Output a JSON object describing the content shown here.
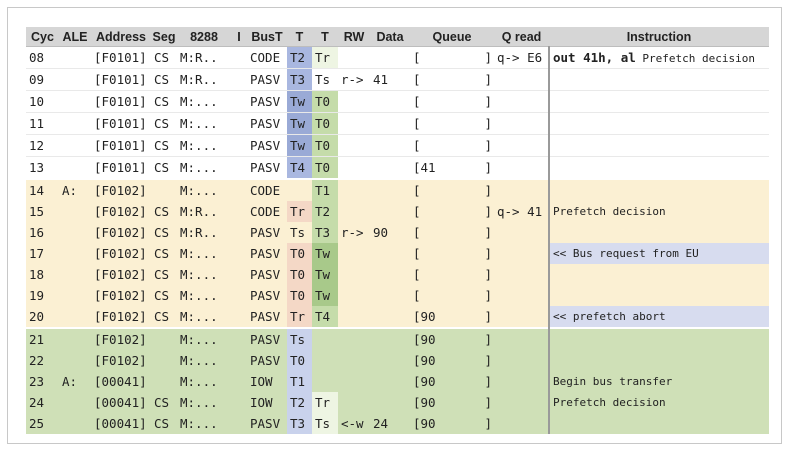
{
  "headers": [
    "Cyc",
    "ALE",
    "Address",
    "Seg",
    "8288",
    "I",
    "BusT",
    "T",
    "T",
    "RW",
    "Data",
    "Queue",
    "Q read",
    "Instruction"
  ],
  "rows": [
    {
      "cyc": "08",
      "ale": "",
      "addr": "[F0101]",
      "seg": "CS",
      "s8288": "M:R..",
      "i": "",
      "bust": "CODE",
      "t1": "T2",
      "t2": "Tr",
      "rw": "",
      "data": "",
      "queue": "[",
      "qend": "]",
      "qread": "q-> E6",
      "instr_bold": "out 41h, al",
      "instr": " Prefetch decision",
      "band": "white",
      "t1c": "code",
      "t2c": "gw",
      "ic": ""
    },
    {
      "cyc": "09",
      "ale": "",
      "addr": "[F0101]",
      "seg": "CS",
      "s8288": "M:R..",
      "i": "",
      "bust": "PASV",
      "t1": "T3",
      "t2": "Ts",
      "rw": "r->",
      "data": "41",
      "queue": "[",
      "qend": "]",
      "qread": "",
      "instr_bold": "",
      "instr": "",
      "band": "white",
      "t1c": "code",
      "t2c": "",
      "ic": ""
    },
    {
      "cyc": "10",
      "ale": "",
      "addr": "[F0101]",
      "seg": "CS",
      "s8288": "M:...",
      "i": "",
      "bust": "PASV",
      "t1": "Tw",
      "t2": "T0",
      "rw": "",
      "data": "",
      "queue": "[",
      "qend": "]",
      "qread": "",
      "instr_bold": "",
      "instr": "",
      "band": "white",
      "t1c": "blue",
      "t2c": "g",
      "ic": ""
    },
    {
      "cyc": "11",
      "ale": "",
      "addr": "[F0101]",
      "seg": "CS",
      "s8288": "M:...",
      "i": "",
      "bust": "PASV",
      "t1": "Tw",
      "t2": "T0",
      "rw": "",
      "data": "",
      "queue": "[",
      "qend": "]",
      "qread": "",
      "instr_bold": "",
      "instr": "",
      "band": "white",
      "t1c": "blue",
      "t2c": "g",
      "ic": ""
    },
    {
      "cyc": "12",
      "ale": "",
      "addr": "[F0101]",
      "seg": "CS",
      "s8288": "M:...",
      "i": "",
      "bust": "PASV",
      "t1": "Tw",
      "t2": "T0",
      "rw": "",
      "data": "",
      "queue": "[",
      "qend": "]",
      "qread": "",
      "instr_bold": "",
      "instr": "",
      "band": "white",
      "t1c": "blue",
      "t2c": "g",
      "ic": ""
    },
    {
      "cyc": "13",
      "ale": "",
      "addr": "[F0101]",
      "seg": "CS",
      "s8288": "M:...",
      "i": "",
      "bust": "PASV",
      "t1": "T4",
      "t2": "T0",
      "rw": "",
      "data": "",
      "queue": "[41",
      "qend": "]",
      "qread": "",
      "instr_bold": "",
      "instr": "",
      "band": "white",
      "t1c": "code",
      "t2c": "g",
      "ic": ""
    },
    {
      "cyc": "14",
      "ale": "A:",
      "addr": "[F0102]",
      "seg": "",
      "s8288": "M:...",
      "i": "",
      "bust": "CODE",
      "t1": "",
      "t2": "T1",
      "rw": "",
      "data": "",
      "queue": "[",
      "qend": "]",
      "qread": "",
      "instr_bold": "",
      "instr": "",
      "band": "tan",
      "t1c": "",
      "t2c": "g",
      "ic": ""
    },
    {
      "cyc": "15",
      "ale": "",
      "addr": "[F0102]",
      "seg": "CS",
      "s8288": "M:R..",
      "i": "",
      "bust": "CODE",
      "t1": "Tr",
      "t2": "T2",
      "rw": "",
      "data": "",
      "queue": "[",
      "qend": "]",
      "qread": "q-> 41",
      "instr_bold": "",
      "instr": "Prefetch decision",
      "band": "tan",
      "t1c": "salmon",
      "t2c": "g",
      "ic": ""
    },
    {
      "cyc": "16",
      "ale": "",
      "addr": "[F0102]",
      "seg": "CS",
      "s8288": "M:R..",
      "i": "",
      "bust": "PASV",
      "t1": "Ts",
      "t2": "T3",
      "rw": "r->",
      "data": "90",
      "queue": "[",
      "qend": "]",
      "qread": "",
      "instr_bold": "",
      "instr": "",
      "band": "tan",
      "t1c": "",
      "t2c": "g",
      "ic": ""
    },
    {
      "cyc": "17",
      "ale": "",
      "addr": "[F0102]",
      "seg": "CS",
      "s8288": "M:...",
      "i": "",
      "bust": "PASV",
      "t1": "T0",
      "t2": "Tw",
      "rw": "",
      "data": "",
      "queue": "[",
      "qend": "]",
      "qread": "",
      "instr_bold": "",
      "instr": "<< Bus request from EU",
      "band": "tan",
      "t1c": "salmon",
      "t2c": "dg",
      "ic": "blue"
    },
    {
      "cyc": "18",
      "ale": "",
      "addr": "[F0102]",
      "seg": "CS",
      "s8288": "M:...",
      "i": "",
      "bust": "PASV",
      "t1": "T0",
      "t2": "Tw",
      "rw": "",
      "data": "",
      "queue": "[",
      "qend": "]",
      "qread": "",
      "instr_bold": "",
      "instr": "",
      "band": "tan",
      "t1c": "salmon",
      "t2c": "dg",
      "ic": ""
    },
    {
      "cyc": "19",
      "ale": "",
      "addr": "[F0102]",
      "seg": "CS",
      "s8288": "M:...",
      "i": "",
      "bust": "PASV",
      "t1": "T0",
      "t2": "Tw",
      "rw": "",
      "data": "",
      "queue": "[",
      "qend": "]",
      "qread": "",
      "instr_bold": "",
      "instr": "",
      "band": "tan",
      "t1c": "salmon",
      "t2c": "dg",
      "ic": ""
    },
    {
      "cyc": "20",
      "ale": "",
      "addr": "[F0102]",
      "seg": "CS",
      "s8288": "M:...",
      "i": "",
      "bust": "PASV",
      "t1": "Tr",
      "t2": "T4",
      "rw": "",
      "data": "",
      "queue": "[90",
      "qend": "]",
      "qread": "",
      "instr_bold": "",
      "instr": "<< prefetch abort",
      "band": "tan",
      "t1c": "salmon",
      "t2c": "g",
      "ic": "blue"
    },
    {
      "cyc": "21",
      "ale": "",
      "addr": "[F0102]",
      "seg": "",
      "s8288": "M:...",
      "i": "",
      "bust": "PASV",
      "t1": "Ts",
      "t2": "",
      "rw": "",
      "data": "",
      "queue": "[90",
      "qend": "]",
      "qread": "",
      "instr_bold": "",
      "instr": "",
      "band": "green",
      "t1c": "lb",
      "t2c": "",
      "ic": ""
    },
    {
      "cyc": "22",
      "ale": "",
      "addr": "[F0102]",
      "seg": "",
      "s8288": "M:...",
      "i": "",
      "bust": "PASV",
      "t1": "T0",
      "t2": "",
      "rw": "",
      "data": "",
      "queue": "[90",
      "qend": "]",
      "qread": "",
      "instr_bold": "",
      "instr": "",
      "band": "green",
      "t1c": "lb",
      "t2c": "",
      "ic": ""
    },
    {
      "cyc": "23",
      "ale": "A:",
      "addr": "[00041]",
      "seg": "",
      "s8288": "M:...",
      "i": "",
      "bust": "IOW",
      "t1": "T1",
      "t2": "",
      "rw": "",
      "data": "",
      "queue": "[90",
      "qend": "]",
      "qread": "",
      "instr_bold": "",
      "instr": "Begin bus transfer",
      "band": "green",
      "t1c": "lb",
      "t2c": "",
      "ic": ""
    },
    {
      "cyc": "24",
      "ale": "",
      "addr": "[00041]",
      "seg": "CS",
      "s8288": "M:...",
      "i": "",
      "bust": "IOW",
      "t1": "T2",
      "t2": "Tr",
      "rw": "",
      "data": "",
      "queue": "[90",
      "qend": "]",
      "qread": "",
      "instr_bold": "",
      "instr": "Prefetch decision",
      "band": "green",
      "t1c": "lb",
      "t2c": "gw",
      "ic": ""
    },
    {
      "cyc": "25",
      "ale": "",
      "addr": "[00041]",
      "seg": "CS",
      "s8288": "M:...",
      "i": "",
      "bust": "PASV",
      "t1": "T3",
      "t2": "Ts",
      "rw": "<-w",
      "data": "24",
      "queue": "[90",
      "qend": "]",
      "qread": "",
      "instr_bold": "",
      "instr": "",
      "band": "green",
      "t1c": "lb",
      "t2c": "gw",
      "ic": ""
    }
  ]
}
